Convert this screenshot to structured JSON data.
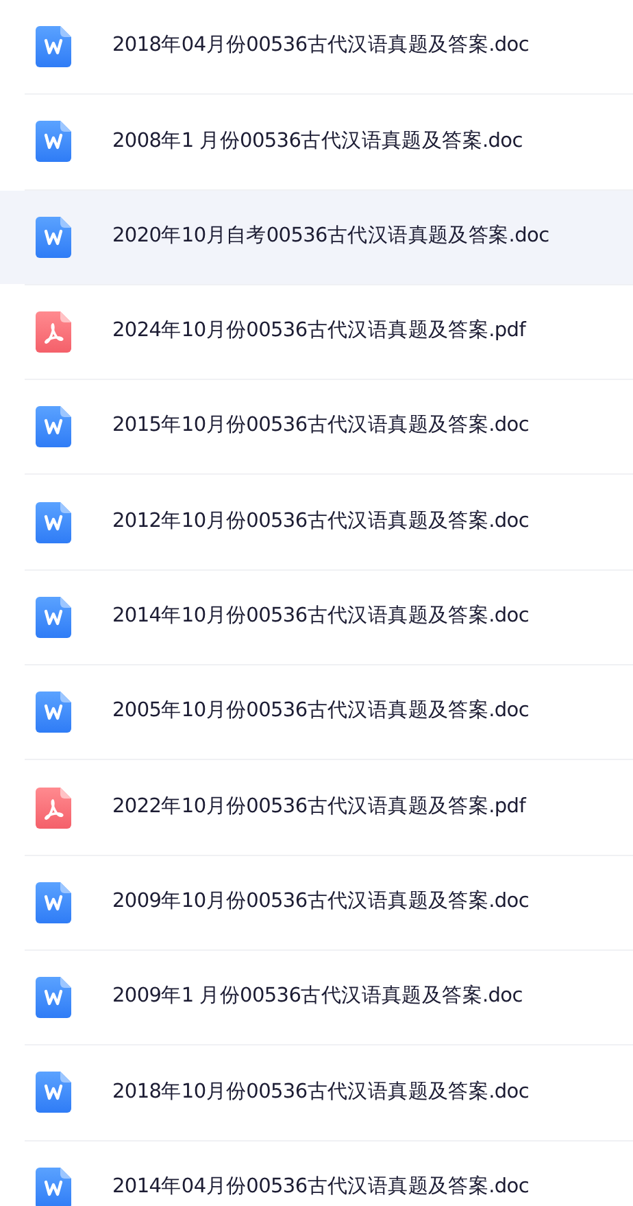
{
  "files": [
    {
      "name": "2018年04月份00536古代汉语真题及答案.doc",
      "kind": "doc",
      "selected": false
    },
    {
      "name": "2008年1 月份00536古代汉语真题及答案.doc",
      "kind": "doc",
      "selected": false
    },
    {
      "name": "2020年10月自考00536古代汉语真题及答案.doc",
      "kind": "doc",
      "selected": true
    },
    {
      "name": "2024年10月份00536古代汉语真题及答案.pdf",
      "kind": "pdf",
      "selected": false
    },
    {
      "name": "2015年10月份00536古代汉语真题及答案.doc",
      "kind": "doc",
      "selected": false
    },
    {
      "name": "2012年10月份00536古代汉语真题及答案.doc",
      "kind": "doc",
      "selected": false
    },
    {
      "name": "2014年10月份00536古代汉语真题及答案.doc",
      "kind": "doc",
      "selected": false
    },
    {
      "name": "2005年10月份00536古代汉语真题及答案.doc",
      "kind": "doc",
      "selected": false
    },
    {
      "name": "2022年10月份00536古代汉语真题及答案.pdf",
      "kind": "pdf",
      "selected": false
    },
    {
      "name": "2009年10月份00536古代汉语真题及答案.doc",
      "kind": "doc",
      "selected": false
    },
    {
      "name": "2009年1 月份00536古代汉语真题及答案.doc",
      "kind": "doc",
      "selected": false
    },
    {
      "name": "2018年10月份00536古代汉语真题及答案.doc",
      "kind": "doc",
      "selected": false
    },
    {
      "name": "2014年04月份00536古代汉语真题及答案.doc",
      "kind": "doc",
      "selected": false
    }
  ]
}
